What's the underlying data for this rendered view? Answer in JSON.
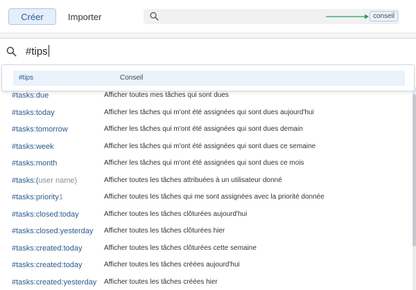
{
  "toolbar": {
    "create_label": "Créer",
    "import_label": "Importer",
    "search_placeholder": "",
    "hint_badge": "conseil",
    "accent_color": "#2a5b8f",
    "arrow_color": "#2e9e5b",
    "icon": "search-icon"
  },
  "query": {
    "value": "#tips",
    "icon": "search-icon"
  },
  "suggestion": {
    "tag": "#tips",
    "description": "Conseil"
  },
  "items": [
    {
      "tag": "#tasks:due",
      "param": "",
      "description": "Afficher toutes mes tâches qui sont dues"
    },
    {
      "tag": "#tasks:today",
      "param": "",
      "description": "Afficher les tâches qui m'ont été assignées qui sont dues aujourd'hui"
    },
    {
      "tag": "#tasks:tomorrow",
      "param": "",
      "description": "Afficher les tâches qui m'ont été assignées qui sont dues demain"
    },
    {
      "tag": "#tasks:week",
      "param": "",
      "description": "Afficher les tâches qui m'ont été assignées qui sont dues ce semaine"
    },
    {
      "tag": "#tasks:month",
      "param": "",
      "description": "Afficher les tâches qui m'ont été assignées qui sont dues ce mois"
    },
    {
      "tag": "#tasks:(",
      "param": "user name)",
      "description": "Afficher toutes les tâches attribuées à un utilisateur donné"
    },
    {
      "tag": "#tasks:priority",
      "param": "1",
      "description": "Afficher toutes les tâches qui me sont assignées avec la priorité donnée"
    },
    {
      "tag": "#tasks:closed:today",
      "param": "",
      "description": "Afficher toutes les tâches clôturées aujourd'hui"
    },
    {
      "tag": "#tasks:closed:yesterday",
      "param": "",
      "description": "Afficher toutes les tâches clôturées hier"
    },
    {
      "tag": "#tasks:created:today",
      "param": "",
      "description": "Afficher toutes les tâches clôturées cette semaine"
    },
    {
      "tag": "#tasks:created:today",
      "param": "",
      "description": "Afficher toutes les tâches créées aujourd'hui"
    },
    {
      "tag": "#tasks:created:yesterday",
      "param": "",
      "description": "Afficher toutes les tâches créées hier"
    }
  ]
}
